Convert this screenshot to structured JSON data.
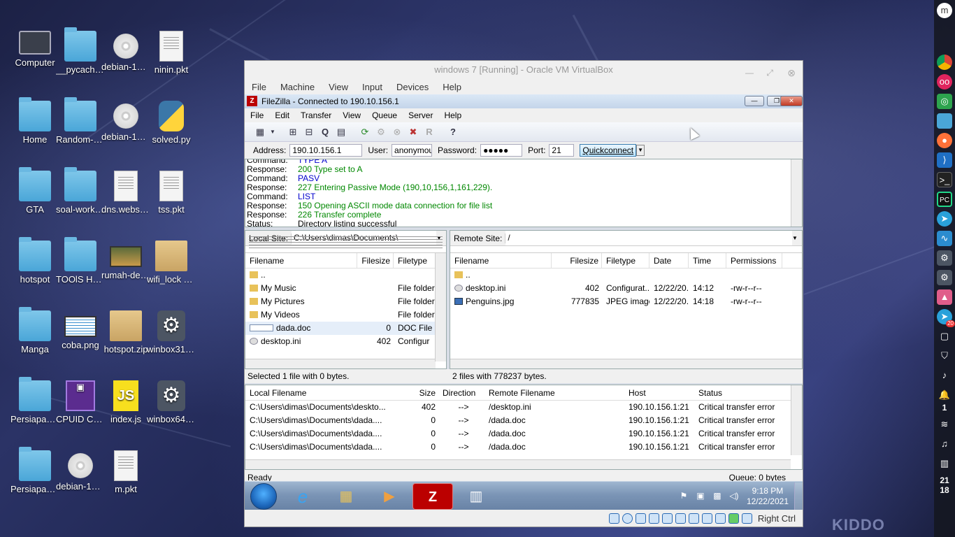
{
  "desktop": {
    "icons": [
      {
        "label": "Computer",
        "type": "monitor"
      },
      {
        "label": "__pycache__",
        "type": "folder"
      },
      {
        "label": "debian-10.6.0-i386-DVD-2.iso",
        "type": "disc"
      },
      {
        "label": "ninin.pkt",
        "type": "doc"
      },
      {
        "label": "Home",
        "type": "folder"
      },
      {
        "label": "Random-Desktop",
        "type": "folder"
      },
      {
        "label": "debian-10.6.0-i386-DVD-3.iso",
        "type": "disc"
      },
      {
        "label": "solved.py",
        "type": "python"
      },
      {
        "label": "GTA",
        "type": "folder"
      },
      {
        "label": "soal-workshop",
        "type": "folder"
      },
      {
        "label": "dns.webserver.pkt",
        "type": "doc"
      },
      {
        "label": "tss.pkt",
        "type": "doc"
      },
      {
        "label": "hotspot",
        "type": "folder"
      },
      {
        "label": "TOOlS Hacking",
        "type": "folder"
      },
      {
        "label": "rumah-devileyes.mp4",
        "type": "video"
      },
      {
        "label": "wifi_lock Teknowle.zip",
        "type": "box"
      },
      {
        "label": "Manga",
        "type": "folder"
      },
      {
        "label": "coba.png",
        "type": "image"
      },
      {
        "label": "hotspot.zip",
        "type": "box"
      },
      {
        "label": "winbox31.exe",
        "type": "gear"
      },
      {
        "label": "Persiapan coderun",
        "type": "folder"
      },
      {
        "label": "CPUID CPU-Z",
        "type": "cpuz"
      },
      {
        "label": "index.js",
        "type": "js"
      },
      {
        "label": "winbox64.exe",
        "type": "gear"
      },
      {
        "label": "Persiapan-ubuntu",
        "type": "folder"
      },
      {
        "label": "debian-10.6.0-i386-DVD-1.iso",
        "type": "disc"
      },
      {
        "label": "m.pkt",
        "type": "doc"
      }
    ],
    "watermark": "KIDDO"
  },
  "dock": {
    "clock_hour": "21",
    "clock_min": "18",
    "notif_count": "1",
    "badge": "20"
  },
  "vbox": {
    "title": "windows 7 [Running] - Oracle VM VirtualBox",
    "menu": [
      "File",
      "Machine",
      "View",
      "Input",
      "Devices",
      "Help"
    ],
    "host_key": "Right Ctrl"
  },
  "filezilla": {
    "title": "FileZilla - Connected to 190.10.156.1",
    "menu": [
      "File",
      "Edit",
      "Transfer",
      "View",
      "Queue",
      "Server",
      "Help"
    ],
    "quickconnect": {
      "address_label": "Address:",
      "address": "190.10.156.1",
      "user_label": "User:",
      "user": "anonymous",
      "password_label": "Password:",
      "password": "●●●●●",
      "port_label": "Port:",
      "port": "21",
      "button": "Quickconnect"
    },
    "log": [
      {
        "kind": "Command:",
        "text": "TYPE A",
        "cls": "cmd"
      },
      {
        "kind": "Response:",
        "text": "200 Type set to A",
        "cls": "resp"
      },
      {
        "kind": "Command:",
        "text": "PASV",
        "cls": "cmd"
      },
      {
        "kind": "Response:",
        "text": "227 Entering Passive Mode (190,10,156,1,161,229).",
        "cls": "resp"
      },
      {
        "kind": "Command:",
        "text": "LIST",
        "cls": "cmd"
      },
      {
        "kind": "Response:",
        "text": "150 Opening ASCII mode data connection for file list",
        "cls": "resp"
      },
      {
        "kind": "Response:",
        "text": "226 Transfer complete",
        "cls": "resp"
      },
      {
        "kind": "Status:",
        "text": "Directory listing successful",
        "cls": "stat"
      }
    ],
    "local": {
      "site_label": "Local Site:",
      "path": "C:\\Users\\dimas\\Documents\\",
      "headers": [
        "Filename",
        "Filesize",
        "Filetype"
      ],
      "rows": [
        {
          "name": "..",
          "size": "",
          "type": "",
          "icon": "folder"
        },
        {
          "name": "My Music",
          "size": "",
          "type": "File folder",
          "icon": "folder"
        },
        {
          "name": "My Pictures",
          "size": "",
          "type": "File folder",
          "icon": "folder"
        },
        {
          "name": "My Videos",
          "size": "",
          "type": "File folder",
          "icon": "folder"
        },
        {
          "name": "dada.doc",
          "size": "0",
          "type": "DOC File",
          "icon": "doc"
        },
        {
          "name": "desktop.ini",
          "size": "402",
          "type": "Configur",
          "icon": "ini"
        }
      ],
      "status": "Selected 1 file with 0 bytes."
    },
    "remote": {
      "site_label": "Remote Site:",
      "path": "/",
      "headers": [
        "Filename",
        "Filesize",
        "Filetype",
        "Date",
        "Time",
        "Permissions"
      ],
      "rows": [
        {
          "name": "..",
          "size": "",
          "type": "",
          "date": "",
          "time": "",
          "perm": "",
          "icon": "folder"
        },
        {
          "name": "desktop.ini",
          "size": "402",
          "type": "Configurat...",
          "date": "12/22/20...",
          "time": "14:12",
          "perm": "-rw-r--r--",
          "icon": "ini"
        },
        {
          "name": "Penguins.jpg",
          "size": "777835",
          "type": "JPEG image",
          "date": "12/22/20...",
          "time": "14:18",
          "perm": "-rw-r--r--",
          "icon": "img"
        }
      ],
      "status": "2 files with 778237 bytes."
    },
    "queue": {
      "headers": [
        "Local Filename",
        "Size",
        "Direction",
        "Remote Filename",
        "Host",
        "Status"
      ],
      "rows": [
        {
          "local": "C:\\Users\\dimas\\Documents\\deskto...",
          "size": "402",
          "dir": "-->",
          "remote": "/desktop.ini",
          "host": "190.10.156.1:21",
          "status": "Critical transfer error"
        },
        {
          "local": "C:\\Users\\dimas\\Documents\\dada....",
          "size": "0",
          "dir": "-->",
          "remote": "/dada.doc",
          "host": "190.10.156.1:21",
          "status": "Critical transfer error"
        },
        {
          "local": "C:\\Users\\dimas\\Documents\\dada....",
          "size": "0",
          "dir": "-->",
          "remote": "/dada.doc",
          "host": "190.10.156.1:21",
          "status": "Critical transfer error"
        },
        {
          "local": "C:\\Users\\dimas\\Documents\\dada....",
          "size": "0",
          "dir": "-->",
          "remote": "/dada.doc",
          "host": "190.10.156.1:21",
          "status": "Critical transfer error"
        }
      ]
    },
    "status_left": "Ready",
    "status_right": "Queue: 0 bytes"
  },
  "win7": {
    "time": "9:18 PM",
    "date": "12/22/2021"
  }
}
